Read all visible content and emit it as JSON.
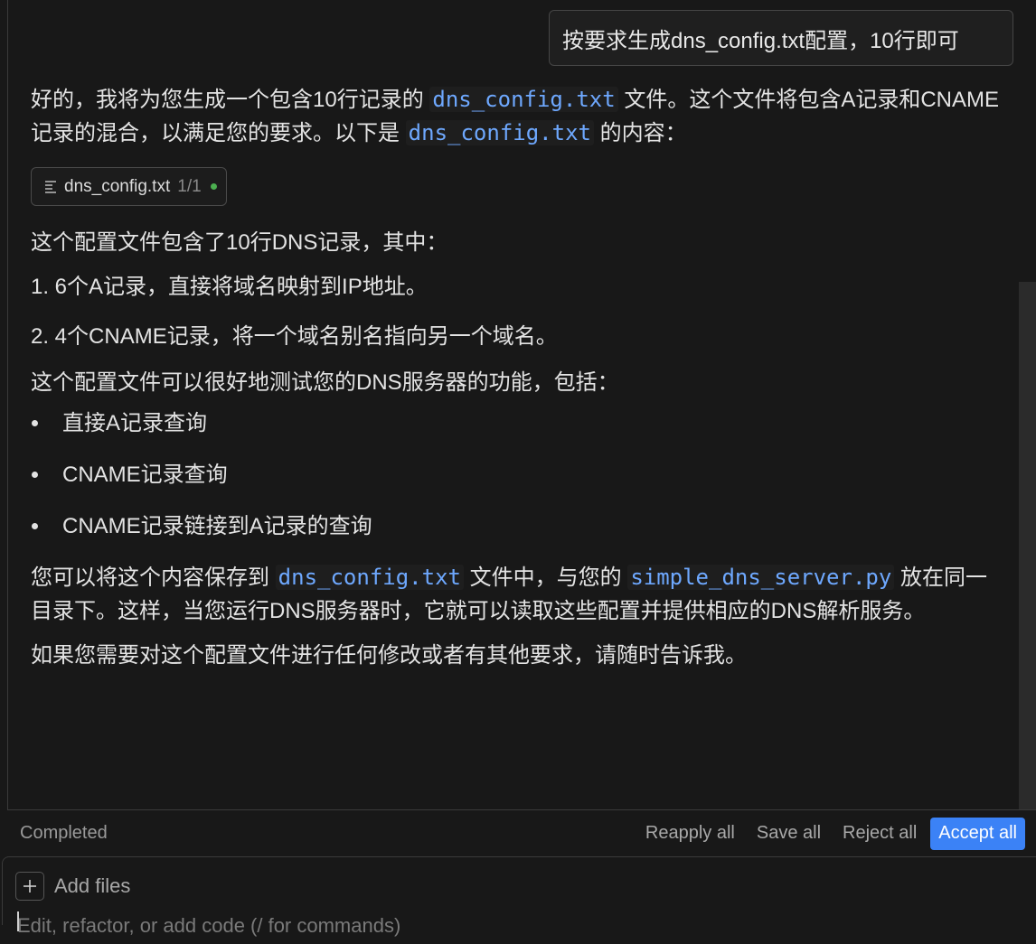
{
  "user_message": "按要求生成dns_config.txt配置，10行即可",
  "assistant": {
    "intro_1": "好的，我将为您生成一个包含10行记录的",
    "intro_code_1": "dns_config.txt",
    "intro_2": "文件。这个文件将包含A记录和CNAME记录的混合，以满足您的要求。以下是",
    "intro_code_2": "dns_config.txt",
    "intro_3": "的内容：",
    "file_chip": {
      "name": "dns_config.txt",
      "count": "1/1"
    },
    "summary": "这个配置文件包含了10行DNS记录，其中：",
    "ordered": [
      "1. 6个A记录，直接将域名映射到IP地址。",
      "2. 4个CNAME记录，将一个域名别名指向另一个域名。"
    ],
    "test_intro": "这个配置文件可以很好地测试您的DNS服务器的功能，包括：",
    "bullets": [
      "直接A记录查询",
      "CNAME记录查询",
      "CNAME记录链接到A记录的查询"
    ],
    "save_1": "您可以将这个内容保存到",
    "save_code_1": "dns_config.txt",
    "save_2": "文件中，与您的",
    "save_code_2": "simple_dns_server.py",
    "save_3": "放在同一目录下。这样，当您运行DNS服务器时，它就可以读取这些配置并提供相应的DNS解析服务。",
    "closing": "如果您需要对这个配置文件进行任何修改或者有其他要求，请随时告诉我。"
  },
  "status_bar": {
    "status": "Completed",
    "reapply_label": "Reapply all",
    "save_label": "Save all",
    "reject_label": "Reject all",
    "accept_label": "Accept all"
  },
  "composer": {
    "add_files_label": "Add files",
    "placeholder": "Edit, refactor, or add code (/ for commands)"
  },
  "colors": {
    "accent": "#3b82f6",
    "code_text": "#6ea8fe",
    "status_dot": "#4caf50"
  }
}
